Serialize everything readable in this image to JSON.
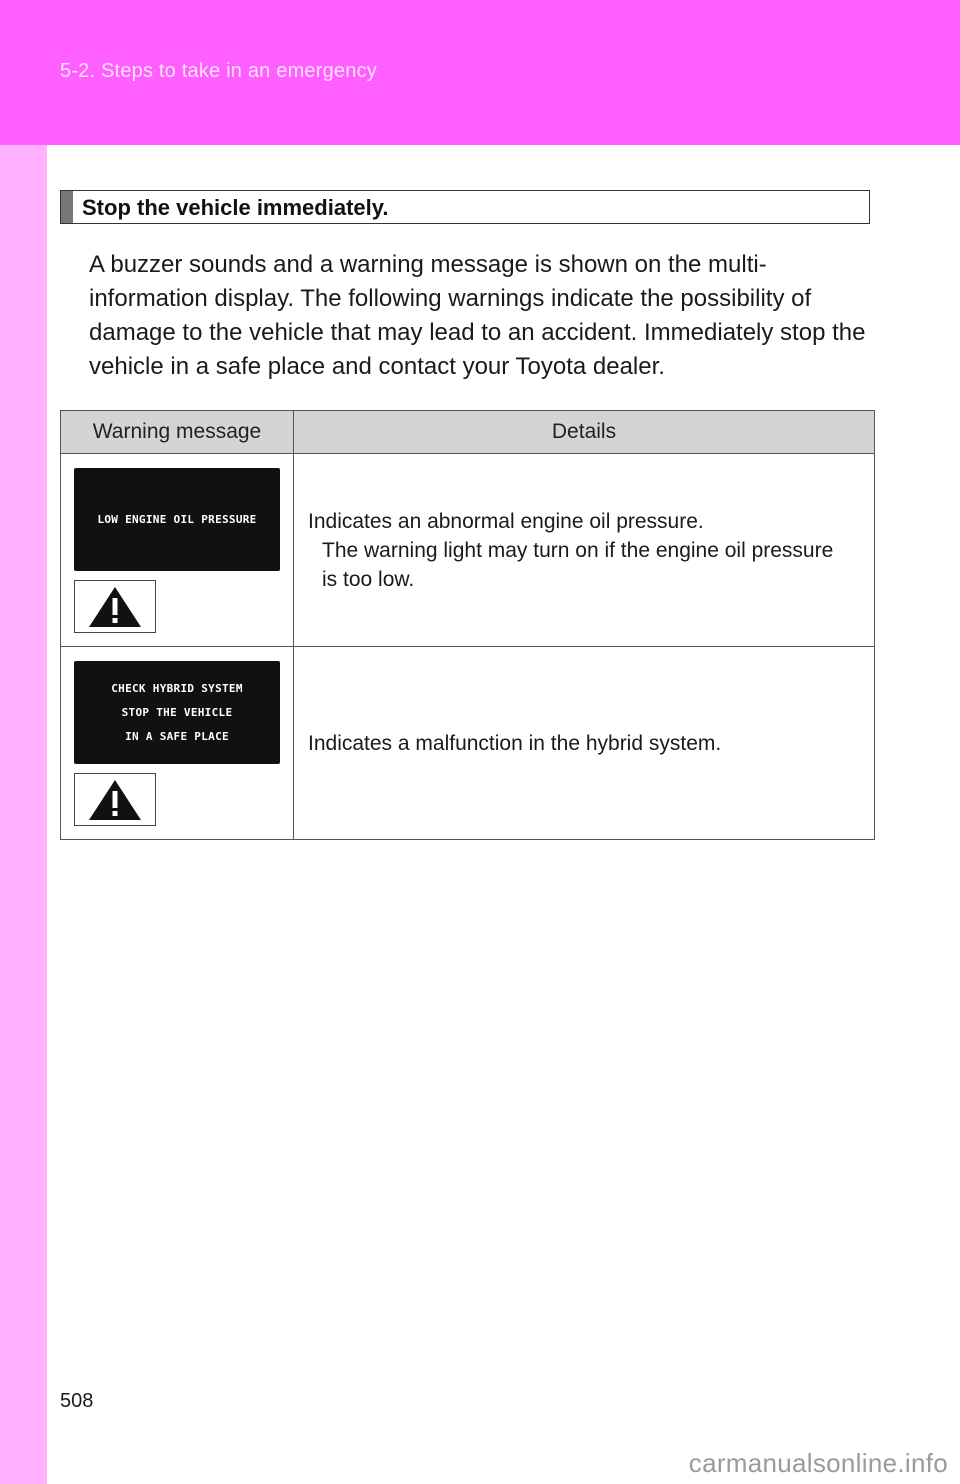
{
  "header": {
    "section_title": "5-2. Steps to take in an emergency"
  },
  "page_number": "508",
  "watermark": "carmanualsonline.info",
  "heading": "Stop the vehicle immediately.",
  "intro": "A buzzer sounds and a warning message is shown on the multi-information display. The following warnings indicate the possibility of damage to the vehicle that may lead to an accident. Immediately stop the vehicle in a safe place and contact your Toyota dealer.",
  "table": {
    "headers": [
      "Warning message",
      "Details"
    ],
    "rows": [
      {
        "display_lines": [
          "LOW ENGINE OIL PRESSURE"
        ],
        "icon": "warning-triangle-icon",
        "details": "Indicates an abnormal engine oil pressure.",
        "sub_details": "The warning light may turn on if the engine oil pressure is too low."
      },
      {
        "display_lines": [
          "CHECK HYBRID SYSTEM",
          "STOP THE VEHICLE",
          "IN A SAFE PLACE"
        ],
        "icon": "warning-triangle-icon",
        "details": "Indicates a malfunction in the hybrid system.",
        "sub_details": ""
      }
    ]
  },
  "colors": {
    "header_band": "#ff5fff",
    "side_strip": "#ffb0ff",
    "table_header_bg": "#d4d4d4",
    "display_bg": "#111111"
  }
}
